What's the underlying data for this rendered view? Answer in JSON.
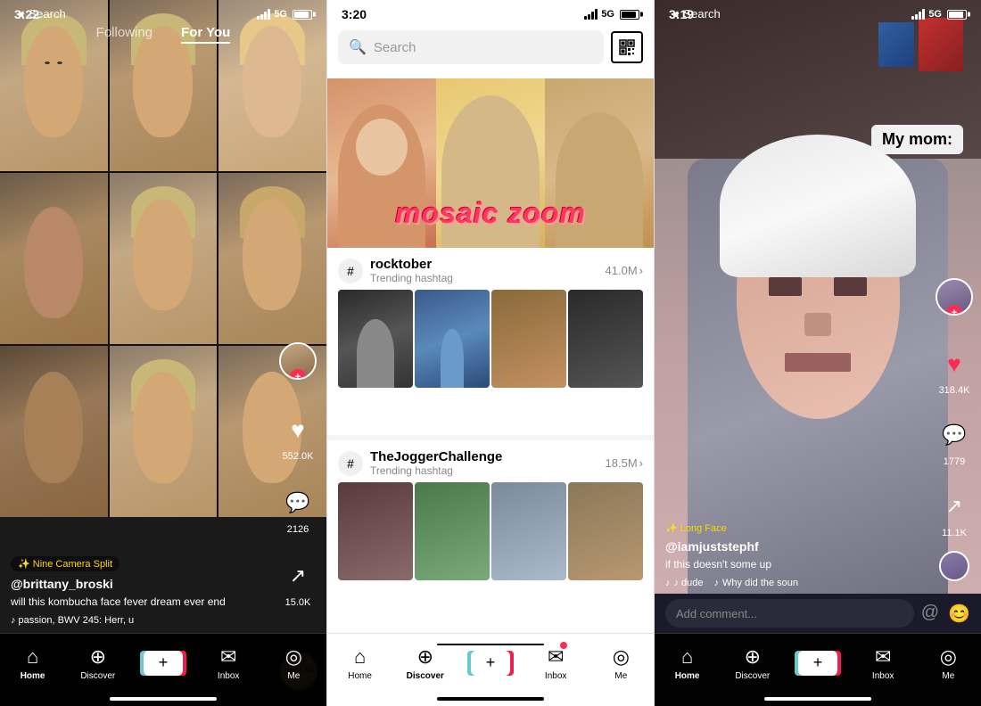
{
  "panel1": {
    "status": {
      "time": "3:22",
      "signal": "5G",
      "battery_indicator": "▮"
    },
    "nav_search": "Search",
    "nav_following": "Following",
    "nav_for_you": "For You",
    "effect_label": "✨ Nine Camera Split",
    "username": "@brittany_broski",
    "caption": "will this kombucha face fever dream ever end",
    "music": "♪ passion, BWV 245: Herr, u",
    "likes": "552.0K",
    "comments": "2126",
    "shares": "15.0K",
    "nav_items": [
      "Home",
      "Discover",
      "+",
      "Inbox",
      "Me"
    ]
  },
  "panel2": {
    "status": {
      "time": "3:20",
      "signal": "5G"
    },
    "search_placeholder": "Search",
    "mosaic_title": "mosaic zoom",
    "trending1": {
      "name": "rocktober",
      "sub": "Trending hashtag",
      "count": "41.0M"
    },
    "trending2": {
      "name": "TheJoggerChallenge",
      "sub": "Trending hashtag",
      "count": "18.5M"
    },
    "nav_items": [
      "Home",
      "Discover",
      "+",
      "Inbox",
      "Me"
    ]
  },
  "panel3": {
    "status": {
      "time": "3:19",
      "signal": "5G"
    },
    "nav_search": "Search",
    "my_mom_label": "My mom:",
    "effect_label": "✨ Long Face",
    "username": "@iamjuststephf",
    "caption": "if this doesn't some up",
    "music_left": "♪ dude",
    "music_right": "Why did the soun",
    "likes": "318.4K",
    "comments": "1779",
    "shares": "11.1K",
    "comment_placeholder": "Add comment...",
    "nav_items": [
      "Home",
      "Discover",
      "+",
      "Inbox",
      "Me"
    ]
  }
}
